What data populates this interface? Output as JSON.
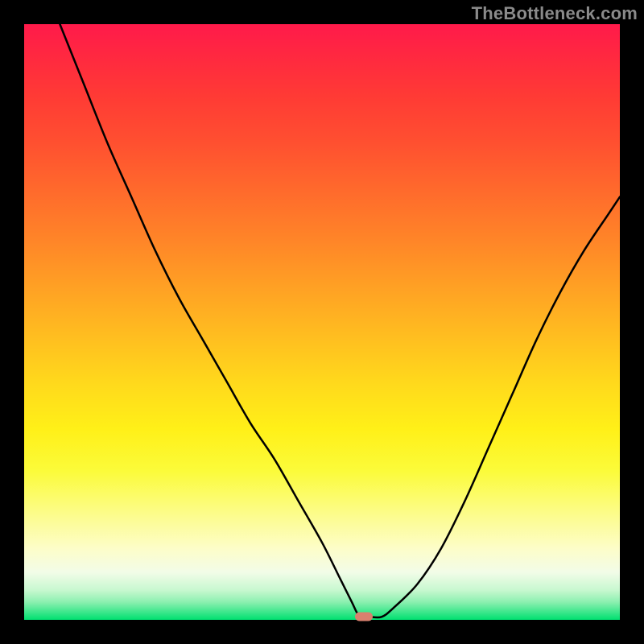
{
  "watermark": "TheBottleneck.com",
  "colors": {
    "curve": "#000000",
    "marker": "#d9806e",
    "frame": "#000000"
  },
  "chart_data": {
    "type": "line",
    "title": "",
    "xlabel": "",
    "ylabel": "",
    "xlim": [
      0,
      100
    ],
    "ylim": [
      0,
      100
    ],
    "grid": false,
    "x": [
      6,
      10,
      14,
      18,
      22,
      26,
      30,
      34,
      38,
      42,
      46,
      50,
      53,
      55,
      56,
      57,
      58,
      60,
      62,
      66,
      70,
      74,
      78,
      82,
      86,
      90,
      94,
      98,
      100
    ],
    "values": [
      100,
      90,
      80,
      71,
      62,
      54,
      47,
      40,
      33,
      27,
      20,
      13,
      7,
      3,
      1,
      0.5,
      0.5,
      0.5,
      2,
      6,
      12,
      20,
      29,
      38,
      47,
      55,
      62,
      68,
      71
    ],
    "minimum": {
      "x": 57,
      "y": 0.5
    },
    "annotations": [
      {
        "text": "TheBottleneck.com",
        "role": "watermark"
      }
    ]
  }
}
